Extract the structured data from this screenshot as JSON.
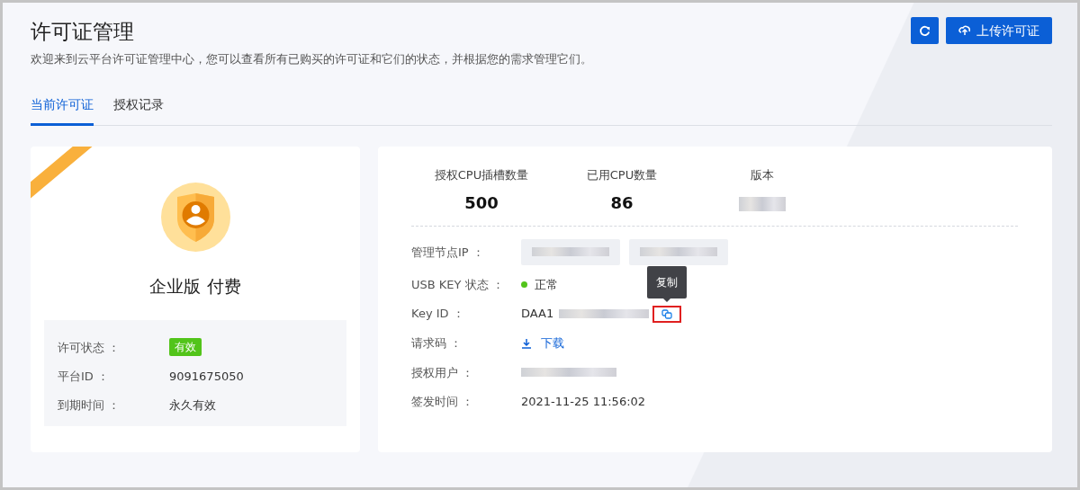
{
  "header": {
    "title": "许可证管理",
    "subtitle": "欢迎来到云平台许可证管理中心，您可以查看所有已购买的许可证和它们的状态，并根据您的需求管理它们。"
  },
  "toolbar": [
    {
      "kind": "refresh"
    },
    {
      "kind": "upload",
      "label": "上传许可证"
    }
  ],
  "tabs": [
    {
      "label": "当前许可证",
      "selected": true
    },
    {
      "label": "授权记录",
      "selected": false
    }
  ],
  "license_card": {
    "edition": "企业版 付费",
    "details": [
      {
        "label": "许可状态 ：",
        "value": "有效",
        "kind": "badge"
      },
      {
        "label": "平台ID ：",
        "value": "9091675050",
        "kind": "text"
      },
      {
        "label": "到期时间 ：",
        "value": "永久有效",
        "kind": "text"
      }
    ]
  },
  "stats": [
    {
      "label": "授权CPU插槽数量",
      "value": "500",
      "kind": "text"
    },
    {
      "label": "已用CPU数量",
      "value": "86",
      "kind": "text"
    },
    {
      "label": "版本",
      "kind": "redacted"
    }
  ],
  "info": [
    {
      "label": "管理节点IP ：",
      "kind": "chips",
      "chips": [
        {
          "kind": "redacted"
        },
        {
          "kind": "redacted"
        }
      ]
    },
    {
      "label": "USB KEY 状态 ：",
      "kind": "status",
      "value": "正常",
      "color": "#52c41a"
    },
    {
      "label": "Key ID ：",
      "kind": "key",
      "value": "DAA1",
      "tooltip": "复制",
      "highlighted": true
    },
    {
      "label": "请求码 ：",
      "kind": "link",
      "value": "下载"
    },
    {
      "label": "授权用户 ：",
      "kind": "redacted"
    },
    {
      "label": "签发时间 ：",
      "kind": "text",
      "value": "2021-11-25 11:56:02"
    }
  ]
}
